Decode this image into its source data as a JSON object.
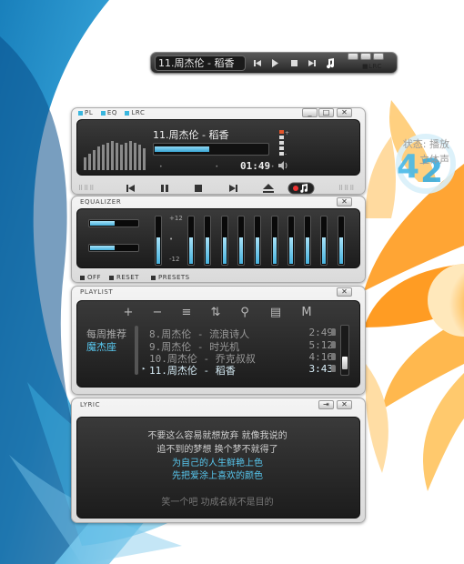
{
  "mini": {
    "title": "11.周杰伦 - 稻香",
    "lrc": "LRC"
  },
  "player": {
    "tabs": [
      "PL",
      "EQ",
      "LRC"
    ],
    "song_title": "11.周杰伦 - 稻香",
    "progress": 0.48,
    "time": "01:49",
    "status": "状态: 播放",
    "stereo": "立体声",
    "visualizer": [
      14,
      18,
      22,
      26,
      28,
      30,
      32,
      30,
      28,
      30,
      32,
      30,
      28,
      24
    ]
  },
  "equalizer": {
    "title": "EQUALIZER",
    "scale_top": "+12",
    "scale_bottom": "-12",
    "preamp": 0.55,
    "bands": [
      0.55,
      0.55,
      0.55,
      0.55,
      0.55,
      0.55,
      0.55,
      0.55,
      0.55,
      0.55
    ],
    "balance": [
      0.5,
      0.5
    ],
    "off_label": "OFF",
    "reset_label": "RESET",
    "presets_label": "PRESETS"
  },
  "playlist": {
    "title": "PLAYLIST",
    "tools": [
      "+",
      "−",
      "≡",
      "⇅",
      "⚲",
      "▤",
      "M"
    ],
    "categories": [
      "每周推荐",
      "魔杰座"
    ],
    "tracks": [
      {
        "title": "8.周杰伦 - 流浪诗人",
        "duration": "2:49"
      },
      {
        "title": "9.周杰伦 - 时光机",
        "duration": "5:12"
      },
      {
        "title": "10.周杰伦 - 乔克叔叔",
        "duration": "4:16"
      },
      {
        "title": "11.周杰伦 - 稻香",
        "duration": "3:43"
      }
    ]
  },
  "lyric": {
    "title": "LYRIC",
    "lines": [
      "不要这么容易就想放弃 就像我说的",
      "追不到的梦想 换个梦不就得了",
      "为自己的人生鲜艳上色",
      "先把爱涂上喜欢的颜色",
      "",
      "笑一个吧 功成名就不是目的"
    ]
  },
  "colors": {
    "accent": "#3fb0dc",
    "panel_dark": "#1c1c1c",
    "shell": "#e6e6e6"
  }
}
